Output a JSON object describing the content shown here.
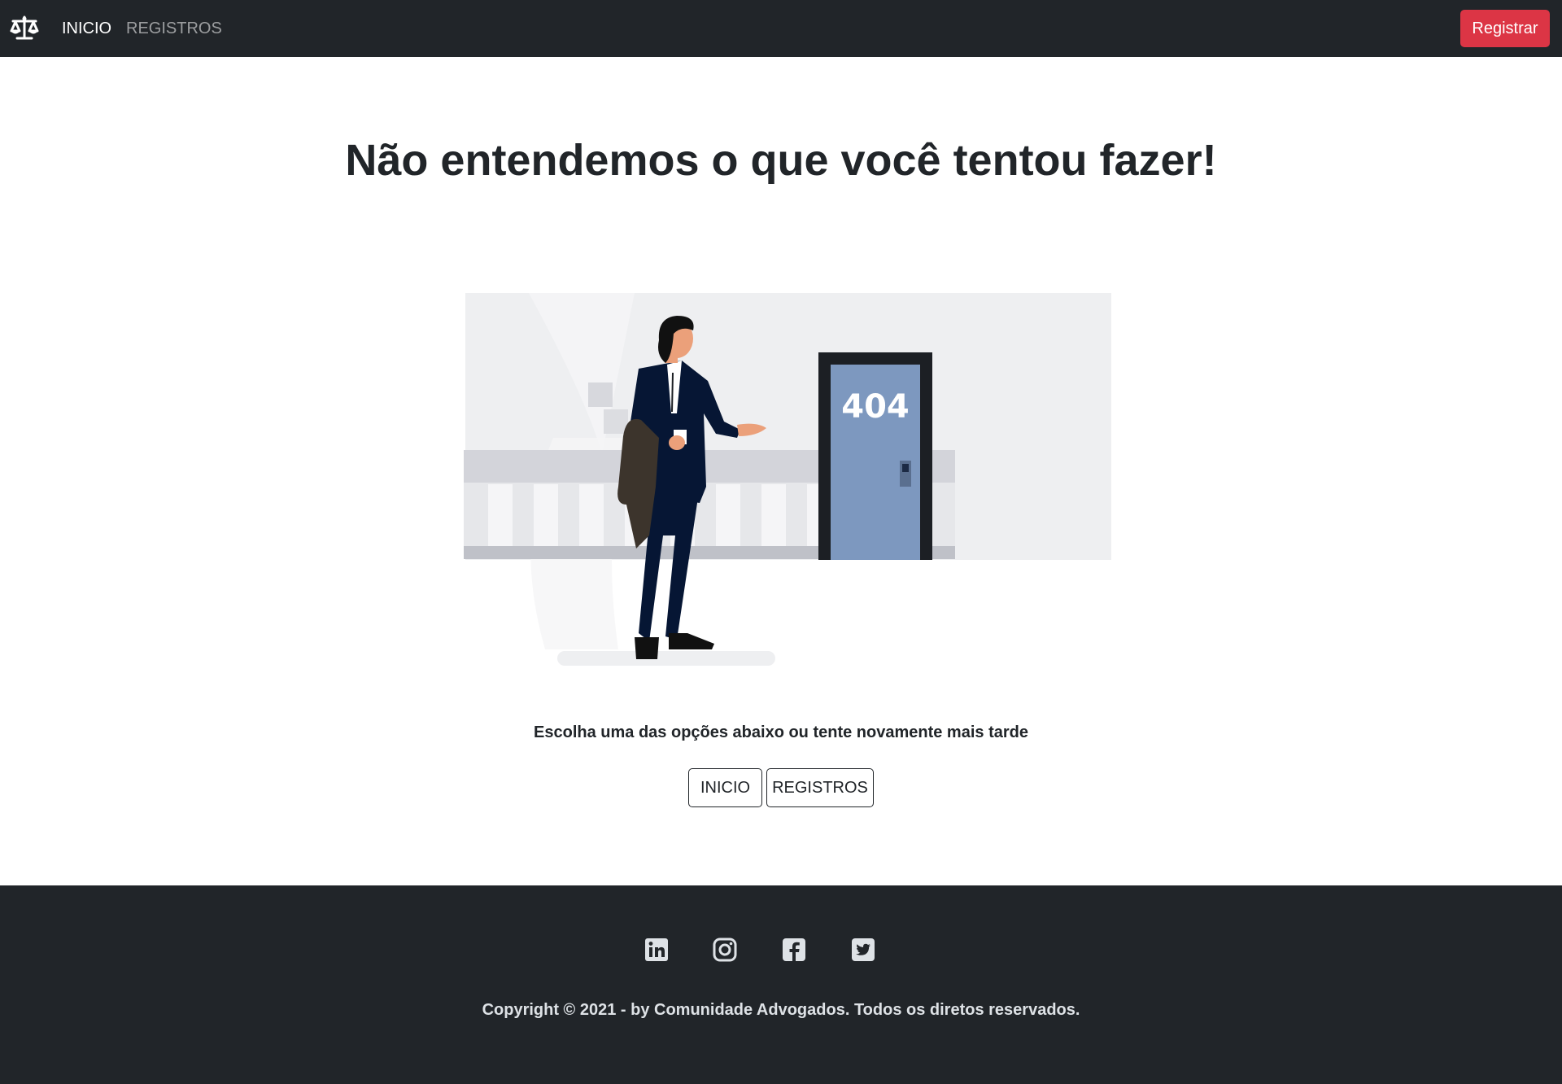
{
  "navbar": {
    "brand_icon": "scale-of-justice-icon",
    "links": [
      "INICIO",
      "REGISTROS"
    ],
    "register_label": "Registrar",
    "register_color": "#dc3545",
    "background": "#212529"
  },
  "main": {
    "title": "Não entendemos o que você tentou fazer!",
    "illustration": {
      "door_number": "404",
      "description_icon": "lawyer-at-404-door-illustration"
    },
    "subtitle": "Escolha uma das opções abaixo ou tente novamente mais tarde",
    "buttons": [
      "INICIO",
      "REGISTROS"
    ]
  },
  "footer": {
    "social_icons": [
      "linkedin-icon",
      "instagram-icon",
      "facebook-icon",
      "twitter-icon"
    ],
    "copyright": "Copyright © 2021 - by Comunidade Advogados. Todos os diretos reservados."
  }
}
